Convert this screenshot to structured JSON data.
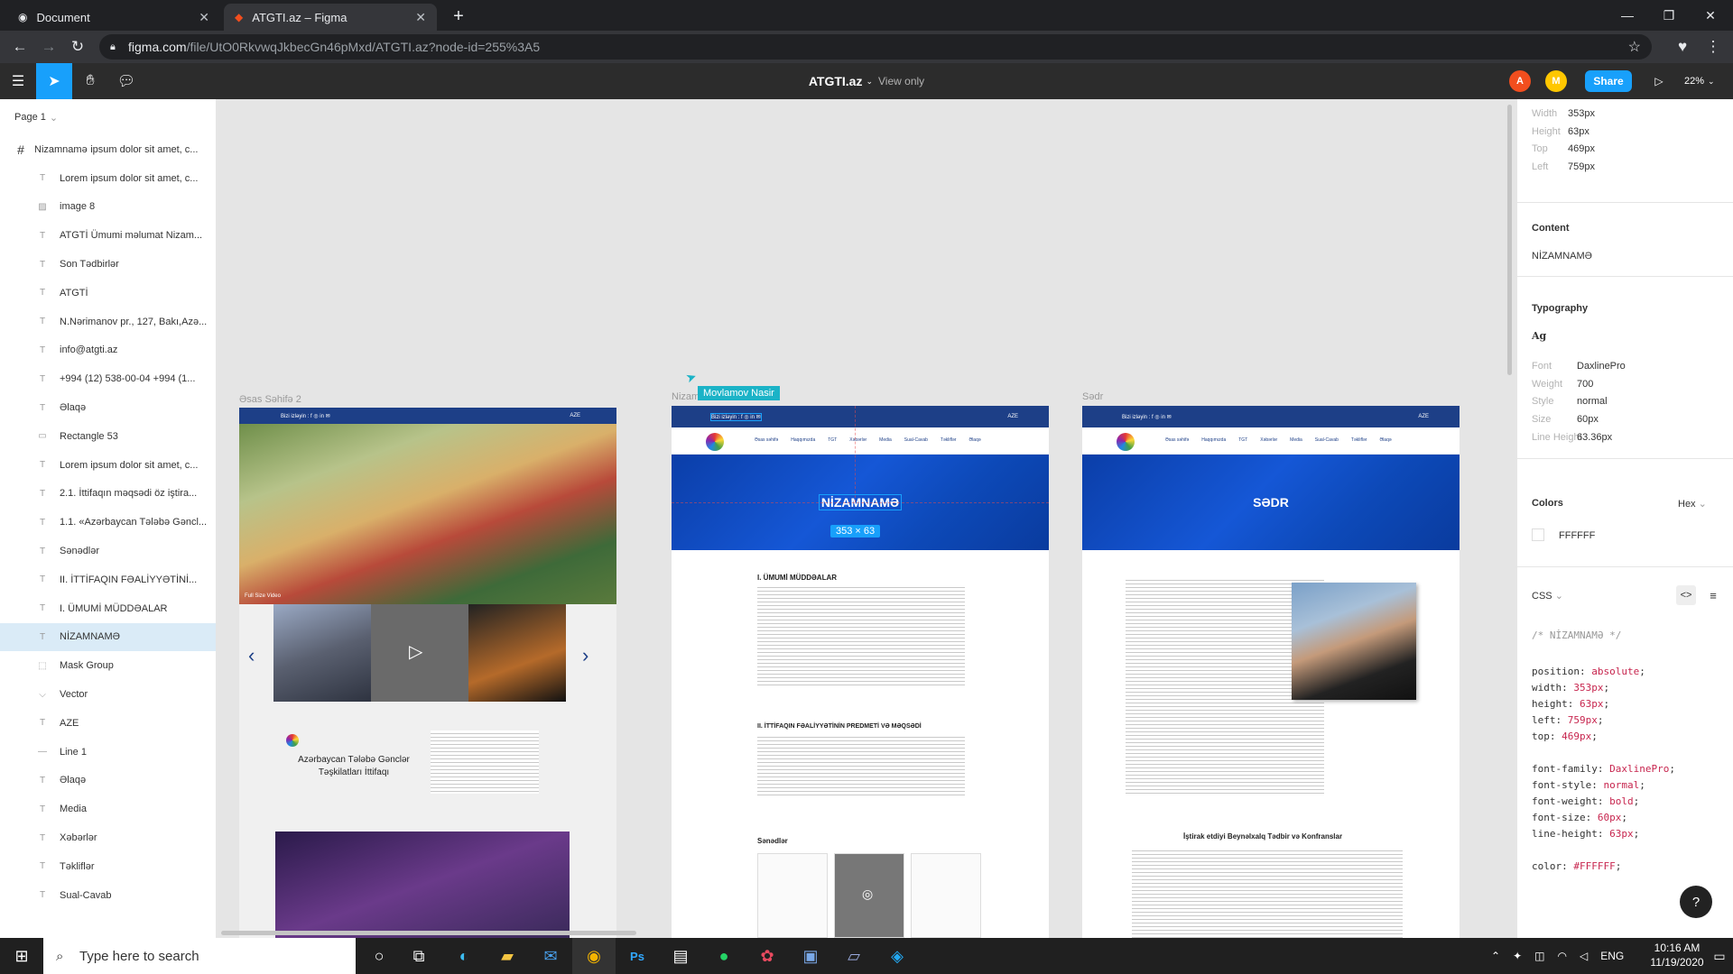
{
  "browser": {
    "tabs": [
      {
        "title": "Document",
        "active": false
      },
      {
        "title": "ATGTI.az – Figma",
        "active": true
      }
    ],
    "url_host": "figma.com",
    "url_path": "/file/UtO0RkvwqJkbecGn46pMxd/ATGTI.az?node-id=255%3A5"
  },
  "figma": {
    "file_name": "ATGTI.az",
    "view_mode": "View only",
    "avatars": [
      {
        "letter": "A",
        "color": "#f24e1e"
      },
      {
        "letter": "M",
        "color": "#ffc700"
      }
    ],
    "share_label": "Share",
    "zoom": "22%"
  },
  "layers": {
    "page": "Page 1",
    "frame_name": "Nizamnamə",
    "items": [
      {
        "icon": "T",
        "label": "Lorem ipsum dolor sit amet, c..."
      },
      {
        "icon": "T",
        "label": "Lorem ipsum dolor sit amet, c..."
      },
      {
        "icon": "img",
        "label": "image 8"
      },
      {
        "icon": "T",
        "label": "ATGTİ Ümumi məlumat Nizam..."
      },
      {
        "icon": "T",
        "label": "Son Tədbirlər"
      },
      {
        "icon": "T",
        "label": "ATGTİ"
      },
      {
        "icon": "T",
        "label": "N.Nərimanov pr., 127, Bakı,Azə..."
      },
      {
        "icon": "T",
        "label": "info@atgti.az"
      },
      {
        "icon": "T",
        "label": "+994 (12) 538-00-04 +994 (1..."
      },
      {
        "icon": "T",
        "label": "Əlaqə"
      },
      {
        "icon": "rect",
        "label": "Rectangle 53"
      },
      {
        "icon": "T",
        "label": "Lorem ipsum dolor sit amet, c..."
      },
      {
        "icon": "T",
        "label": "2.1. İttifaqın məqsədi öz iştira..."
      },
      {
        "icon": "T",
        "label": "1.1. «Azərbaycan Tələbə Gəncl..."
      },
      {
        "icon": "T",
        "label": "Sənədlər"
      },
      {
        "icon": "T",
        "label": "II. İTTİFAQIN FƏALİYYƏTİNİ..."
      },
      {
        "icon": "T",
        "label": "I. ÜMUMİ MÜDDƏALAR"
      },
      {
        "icon": "T",
        "label": "NİZAMNAMƏ",
        "selected": true
      },
      {
        "icon": "mask",
        "label": "Mask Group"
      },
      {
        "icon": "vec",
        "label": "Vector"
      },
      {
        "icon": "T",
        "label": "AZE"
      },
      {
        "icon": "line",
        "label": "Line 1"
      },
      {
        "icon": "T",
        "label": "Əlaqə"
      },
      {
        "icon": "T",
        "label": "Media"
      },
      {
        "icon": "T",
        "label": "Xəbərlər"
      },
      {
        "icon": "T",
        "label": "Təkliflər"
      },
      {
        "icon": "T",
        "label": "Sual-Cavab"
      }
    ]
  },
  "canvas": {
    "frame_labels": [
      "Əsas Səhifə 2",
      "Nizam",
      "Sədr"
    ],
    "cursor_user": "Movlamov Nasir",
    "selection_size": "353 × 63",
    "frame1": {
      "strip_text": "Bizi izləyin : f ◎ in ✉",
      "lang": "AZE",
      "video_label": "Full Size Video",
      "org_name": "Azərbaycan Tələbə Gənclər Təşkilatları İttifaqı"
    },
    "frame2": {
      "strip_text": "Bizi izləyin : f ◎ in ✉",
      "lang": "AZE",
      "nav": [
        "Əsas səhifə",
        "Haqqımızda",
        "TGT",
        "Xəbərlər",
        "Media",
        "Sual-Cavab",
        "Təkliflər",
        "Əlaqə"
      ],
      "hero_title": "NİZAMNAMƏ",
      "section1": "I. ÜMUMİ MÜDDƏALAR",
      "section2": "II. İTTİFAQIN FƏALİYYƏTİNİN PREDMETİ VƏ MƏQSƏDİ",
      "docs": "Sənədlər"
    },
    "frame3": {
      "strip_text": "Bizi izləyin : f ◎ in ✉",
      "lang": "AZE",
      "hero_title": "SƏDR",
      "events_title": "İştirak etdiyi Beynəlxalq Tədbir və Konfranslar"
    }
  },
  "properties": {
    "geometry": [
      {
        "label": "Width",
        "value": "353px"
      },
      {
        "label": "Height",
        "value": "63px"
      },
      {
        "label": "Top",
        "value": "469px"
      },
      {
        "label": "Left",
        "value": "759px"
      }
    ],
    "content_title": "Content",
    "content_value": "NİZAMNAMƏ",
    "typography_title": "Typography",
    "typography_sample": "Ag",
    "typography": [
      {
        "label": "Font",
        "value": "DaxlinePro"
      },
      {
        "label": "Weight",
        "value": "700"
      },
      {
        "label": "Style",
        "value": "normal"
      },
      {
        "label": "Size",
        "value": "60px"
      },
      {
        "label": "Line Height",
        "value": "63.36px"
      }
    ],
    "colors_title": "Colors",
    "color_format": "Hex",
    "color_value": "FFFFFF",
    "css_title": "CSS",
    "css_comment": "/* NİZAMNAMƏ */",
    "css": [
      {
        "k": "position",
        "v": "absolute"
      },
      {
        "k": "width",
        "v": "353px"
      },
      {
        "k": "height",
        "v": "63px"
      },
      {
        "k": "left",
        "v": "759px"
      },
      {
        "k": "top",
        "v": "469px"
      },
      {
        "k": "font-family",
        "v": "DaxlinePro"
      },
      {
        "k": "font-style",
        "v": "normal"
      },
      {
        "k": "font-weight",
        "v": "bold"
      },
      {
        "k": "font-size",
        "v": "60px"
      },
      {
        "k": "line-height",
        "v": "63px"
      },
      {
        "k": "color",
        "v": "#FFFFFF"
      }
    ]
  },
  "taskbar": {
    "search_placeholder": "Type here to search",
    "lang": "ENG",
    "time": "10:16 AM",
    "date": "11/19/2020"
  },
  "colors": {
    "figma_blue": "#18a0fb",
    "selection_bg": "#daebf7",
    "hero_blue": "#1557d6"
  }
}
